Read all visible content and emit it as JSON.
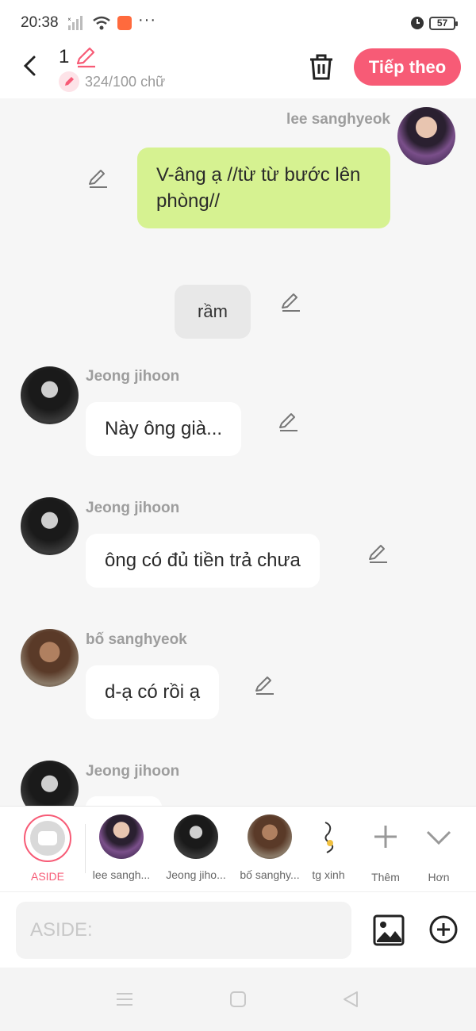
{
  "status": {
    "time": "20:38",
    "battery": "57"
  },
  "header": {
    "title_number": "1",
    "char_count": "324/100 chữ",
    "next_label": "Tiếp theo"
  },
  "messages": [
    {
      "speaker": "lee sanghyeok",
      "text": "V-âng ạ //từ từ bước lên phòng//"
    },
    {
      "speaker": "",
      "text": "rầm"
    },
    {
      "speaker": "Jeong jihoon",
      "text": "Này ông già..."
    },
    {
      "speaker": "Jeong jihoon",
      "text": "ông có đủ tiền trả chưa"
    },
    {
      "speaker": "bố sanghyeok",
      "text": "d-ạ có rồi ạ"
    },
    {
      "speaker": "Jeong jihoon",
      "text": ""
    }
  ],
  "characters": {
    "aside_label": "ASIDE",
    "items": [
      {
        "label": "lee sangh..."
      },
      {
        "label": "Jeong jiho..."
      },
      {
        "label": "bố sanghy..."
      },
      {
        "label": "tg xinh"
      }
    ],
    "add_label": "Thêm",
    "more_label": "Hơn"
  },
  "input": {
    "placeholder": "ASIDE:"
  },
  "colors": {
    "accent": "#f75b76",
    "own_bubble": "#d6f291",
    "background": "#f6f6f6"
  }
}
